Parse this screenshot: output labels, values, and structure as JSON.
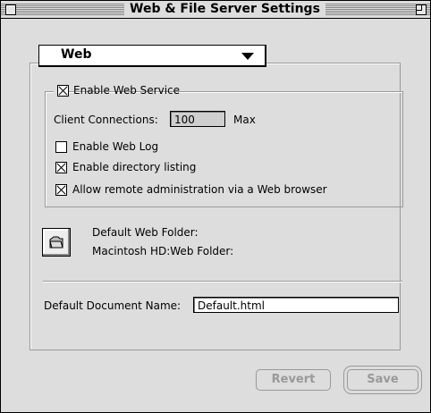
{
  "window": {
    "title": "Web & File Server Settings"
  },
  "popup": {
    "selected": "Web"
  },
  "web_service": {
    "enable_label": "Enable Web Service",
    "enable_checked": true,
    "client_connections_label": "Client Connections:",
    "client_connections_value": "100",
    "client_connections_suffix": "Max",
    "enable_web_log_label": "Enable Web Log",
    "enable_web_log_checked": false,
    "directory_listing_label": "Enable directory listing",
    "directory_listing_checked": true,
    "remote_admin_label": "Allow remote administration via a Web browser",
    "remote_admin_checked": true
  },
  "folder": {
    "label": "Default Web Folder:",
    "path": "Macintosh HD:Web Folder:"
  },
  "document": {
    "label": "Default Document Name:",
    "value": "Default.html"
  },
  "buttons": {
    "revert": "Revert",
    "save": "Save"
  }
}
